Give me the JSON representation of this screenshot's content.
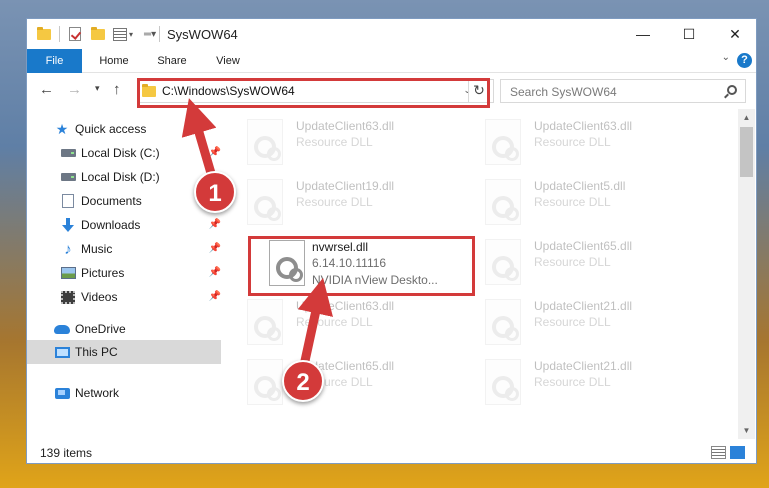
{
  "window": {
    "title": "SysWOW64",
    "controls": {
      "minimize": "—",
      "maximize": "☐",
      "close": "✕"
    }
  },
  "ribbon": {
    "tabs": [
      "File",
      "Home",
      "Share",
      "View"
    ],
    "help": "?"
  },
  "address_bar": {
    "path": "C:\\Windows\\SysWOW64",
    "search_placeholder": "Search SysWOW64"
  },
  "navigation": {
    "quick_access": "Quick access",
    "items": [
      {
        "label": "Local Disk (C:)",
        "pinned": true
      },
      {
        "label": "Local Disk (D:)",
        "pinned": false
      },
      {
        "label": "Documents",
        "pinned": true
      },
      {
        "label": "Downloads",
        "pinned": true
      },
      {
        "label": "Music",
        "pinned": true
      },
      {
        "label": "Pictures",
        "pinned": true
      },
      {
        "label": "Videos",
        "pinned": true
      }
    ],
    "onedrive": "OneDrive",
    "this_pc": "This PC",
    "network": "Network"
  },
  "files": {
    "left": [
      {
        "name": "UpdateClient63.dll",
        "line2": "Resource DLL"
      },
      {
        "name": "UpdateClient19.dll",
        "line2": "Resource DLL"
      },
      {
        "name": "nvwrsel.dll",
        "line2": "6.14.10.11116",
        "line3": "NVIDIA nView Deskto..."
      },
      {
        "name": "UpdateClient63.dll",
        "line2": "Resource DLL"
      },
      {
        "name": "UpdateClient65.dll",
        "line2": "Resource DLL"
      }
    ],
    "right": [
      {
        "name": "UpdateClient63.dll",
        "line2": "Resource DLL"
      },
      {
        "name": "UpdateClient5.dll",
        "line2": "Resource DLL"
      },
      {
        "name": "UpdateClient65.dll",
        "line2": "Resource DLL"
      },
      {
        "name": "UpdateClient21.dll",
        "line2": "Resource DLL"
      },
      {
        "name": "UpdateClient21.dll",
        "line2": "Resource DLL"
      }
    ]
  },
  "status": {
    "items": "139 items"
  },
  "callouts": {
    "one": "1",
    "two": "2"
  },
  "colors": {
    "accent": "#1979ca",
    "highlight": "#d33a3a",
    "selection": "#d9d9d9"
  }
}
